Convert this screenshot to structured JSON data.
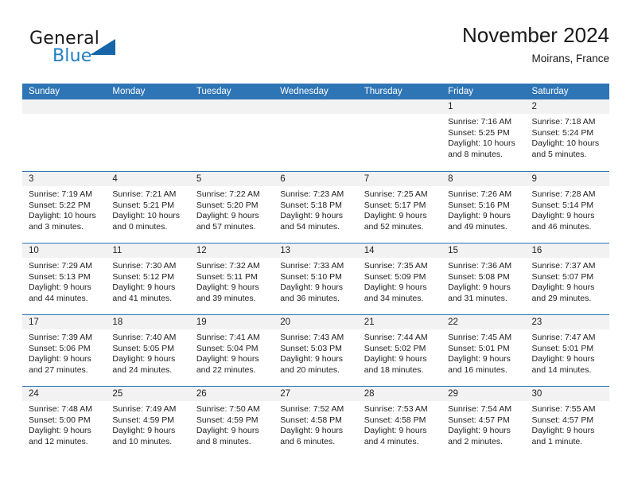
{
  "brand": {
    "word_one": "General",
    "word_two": "Blue",
    "triangle_color": "#1565a8",
    "blue_color": "#1f7fc4"
  },
  "header": {
    "title": "November 2024",
    "subtitle": "Moirans, France"
  },
  "theme": {
    "header_blue": "#2e75b6",
    "day_band_gray": "#f2f2f2"
  },
  "weekdays": [
    "Sunday",
    "Monday",
    "Tuesday",
    "Wednesday",
    "Thursday",
    "Friday",
    "Saturday"
  ],
  "weeks": [
    [
      {
        "day": "",
        "empty": true,
        "sunrise": "",
        "sunset": "",
        "daylight_a": "",
        "daylight_b": ""
      },
      {
        "day": "",
        "empty": true,
        "sunrise": "",
        "sunset": "",
        "daylight_a": "",
        "daylight_b": ""
      },
      {
        "day": "",
        "empty": true,
        "sunrise": "",
        "sunset": "",
        "daylight_a": "",
        "daylight_b": ""
      },
      {
        "day": "",
        "empty": true,
        "sunrise": "",
        "sunset": "",
        "daylight_a": "",
        "daylight_b": ""
      },
      {
        "day": "",
        "empty": true,
        "sunrise": "",
        "sunset": "",
        "daylight_a": "",
        "daylight_b": ""
      },
      {
        "day": "1",
        "empty": false,
        "sunrise": "Sunrise: 7:16 AM",
        "sunset": "Sunset: 5:25 PM",
        "daylight_a": "Daylight: 10 hours",
        "daylight_b": "and 8 minutes."
      },
      {
        "day": "2",
        "empty": false,
        "sunrise": "Sunrise: 7:18 AM",
        "sunset": "Sunset: 5:24 PM",
        "daylight_a": "Daylight: 10 hours",
        "daylight_b": "and 5 minutes."
      }
    ],
    [
      {
        "day": "3",
        "empty": false,
        "sunrise": "Sunrise: 7:19 AM",
        "sunset": "Sunset: 5:22 PM",
        "daylight_a": "Daylight: 10 hours",
        "daylight_b": "and 3 minutes."
      },
      {
        "day": "4",
        "empty": false,
        "sunrise": "Sunrise: 7:21 AM",
        "sunset": "Sunset: 5:21 PM",
        "daylight_a": "Daylight: 10 hours",
        "daylight_b": "and 0 minutes."
      },
      {
        "day": "5",
        "empty": false,
        "sunrise": "Sunrise: 7:22 AM",
        "sunset": "Sunset: 5:20 PM",
        "daylight_a": "Daylight: 9 hours",
        "daylight_b": "and 57 minutes."
      },
      {
        "day": "6",
        "empty": false,
        "sunrise": "Sunrise: 7:23 AM",
        "sunset": "Sunset: 5:18 PM",
        "daylight_a": "Daylight: 9 hours",
        "daylight_b": "and 54 minutes."
      },
      {
        "day": "7",
        "empty": false,
        "sunrise": "Sunrise: 7:25 AM",
        "sunset": "Sunset: 5:17 PM",
        "daylight_a": "Daylight: 9 hours",
        "daylight_b": "and 52 minutes."
      },
      {
        "day": "8",
        "empty": false,
        "sunrise": "Sunrise: 7:26 AM",
        "sunset": "Sunset: 5:16 PM",
        "daylight_a": "Daylight: 9 hours",
        "daylight_b": "and 49 minutes."
      },
      {
        "day": "9",
        "empty": false,
        "sunrise": "Sunrise: 7:28 AM",
        "sunset": "Sunset: 5:14 PM",
        "daylight_a": "Daylight: 9 hours",
        "daylight_b": "and 46 minutes."
      }
    ],
    [
      {
        "day": "10",
        "empty": false,
        "sunrise": "Sunrise: 7:29 AM",
        "sunset": "Sunset: 5:13 PM",
        "daylight_a": "Daylight: 9 hours",
        "daylight_b": "and 44 minutes."
      },
      {
        "day": "11",
        "empty": false,
        "sunrise": "Sunrise: 7:30 AM",
        "sunset": "Sunset: 5:12 PM",
        "daylight_a": "Daylight: 9 hours",
        "daylight_b": "and 41 minutes."
      },
      {
        "day": "12",
        "empty": false,
        "sunrise": "Sunrise: 7:32 AM",
        "sunset": "Sunset: 5:11 PM",
        "daylight_a": "Daylight: 9 hours",
        "daylight_b": "and 39 minutes."
      },
      {
        "day": "13",
        "empty": false,
        "sunrise": "Sunrise: 7:33 AM",
        "sunset": "Sunset: 5:10 PM",
        "daylight_a": "Daylight: 9 hours",
        "daylight_b": "and 36 minutes."
      },
      {
        "day": "14",
        "empty": false,
        "sunrise": "Sunrise: 7:35 AM",
        "sunset": "Sunset: 5:09 PM",
        "daylight_a": "Daylight: 9 hours",
        "daylight_b": "and 34 minutes."
      },
      {
        "day": "15",
        "empty": false,
        "sunrise": "Sunrise: 7:36 AM",
        "sunset": "Sunset: 5:08 PM",
        "daylight_a": "Daylight: 9 hours",
        "daylight_b": "and 31 minutes."
      },
      {
        "day": "16",
        "empty": false,
        "sunrise": "Sunrise: 7:37 AM",
        "sunset": "Sunset: 5:07 PM",
        "daylight_a": "Daylight: 9 hours",
        "daylight_b": "and 29 minutes."
      }
    ],
    [
      {
        "day": "17",
        "empty": false,
        "sunrise": "Sunrise: 7:39 AM",
        "sunset": "Sunset: 5:06 PM",
        "daylight_a": "Daylight: 9 hours",
        "daylight_b": "and 27 minutes."
      },
      {
        "day": "18",
        "empty": false,
        "sunrise": "Sunrise: 7:40 AM",
        "sunset": "Sunset: 5:05 PM",
        "daylight_a": "Daylight: 9 hours",
        "daylight_b": "and 24 minutes."
      },
      {
        "day": "19",
        "empty": false,
        "sunrise": "Sunrise: 7:41 AM",
        "sunset": "Sunset: 5:04 PM",
        "daylight_a": "Daylight: 9 hours",
        "daylight_b": "and 22 minutes."
      },
      {
        "day": "20",
        "empty": false,
        "sunrise": "Sunrise: 7:43 AM",
        "sunset": "Sunset: 5:03 PM",
        "daylight_a": "Daylight: 9 hours",
        "daylight_b": "and 20 minutes."
      },
      {
        "day": "21",
        "empty": false,
        "sunrise": "Sunrise: 7:44 AM",
        "sunset": "Sunset: 5:02 PM",
        "daylight_a": "Daylight: 9 hours",
        "daylight_b": "and 18 minutes."
      },
      {
        "day": "22",
        "empty": false,
        "sunrise": "Sunrise: 7:45 AM",
        "sunset": "Sunset: 5:01 PM",
        "daylight_a": "Daylight: 9 hours",
        "daylight_b": "and 16 minutes."
      },
      {
        "day": "23",
        "empty": false,
        "sunrise": "Sunrise: 7:47 AM",
        "sunset": "Sunset: 5:01 PM",
        "daylight_a": "Daylight: 9 hours",
        "daylight_b": "and 14 minutes."
      }
    ],
    [
      {
        "day": "24",
        "empty": false,
        "sunrise": "Sunrise: 7:48 AM",
        "sunset": "Sunset: 5:00 PM",
        "daylight_a": "Daylight: 9 hours",
        "daylight_b": "and 12 minutes."
      },
      {
        "day": "25",
        "empty": false,
        "sunrise": "Sunrise: 7:49 AM",
        "sunset": "Sunset: 4:59 PM",
        "daylight_a": "Daylight: 9 hours",
        "daylight_b": "and 10 minutes."
      },
      {
        "day": "26",
        "empty": false,
        "sunrise": "Sunrise: 7:50 AM",
        "sunset": "Sunset: 4:59 PM",
        "daylight_a": "Daylight: 9 hours",
        "daylight_b": "and 8 minutes."
      },
      {
        "day": "27",
        "empty": false,
        "sunrise": "Sunrise: 7:52 AM",
        "sunset": "Sunset: 4:58 PM",
        "daylight_a": "Daylight: 9 hours",
        "daylight_b": "and 6 minutes."
      },
      {
        "day": "28",
        "empty": false,
        "sunrise": "Sunrise: 7:53 AM",
        "sunset": "Sunset: 4:58 PM",
        "daylight_a": "Daylight: 9 hours",
        "daylight_b": "and 4 minutes."
      },
      {
        "day": "29",
        "empty": false,
        "sunrise": "Sunrise: 7:54 AM",
        "sunset": "Sunset: 4:57 PM",
        "daylight_a": "Daylight: 9 hours",
        "daylight_b": "and 2 minutes."
      },
      {
        "day": "30",
        "empty": false,
        "sunrise": "Sunrise: 7:55 AM",
        "sunset": "Sunset: 4:57 PM",
        "daylight_a": "Daylight: 9 hours",
        "daylight_b": "and 1 minute."
      }
    ]
  ]
}
